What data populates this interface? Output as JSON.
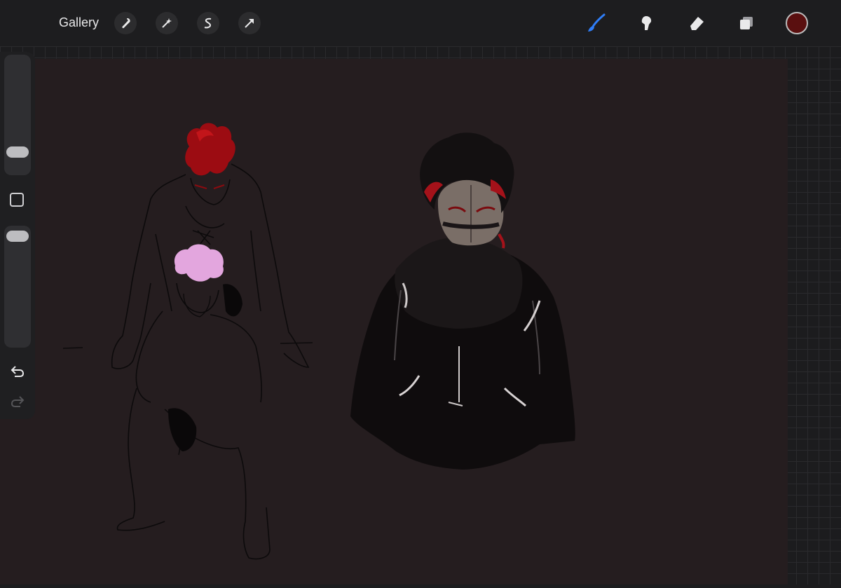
{
  "toolbar": {
    "gallery_label": "Gallery",
    "left_tools": [
      "wrench-icon",
      "magic-wand-icon",
      "selection-icon",
      "transform-arrow-icon"
    ],
    "right_tools": [
      "brush-icon",
      "smudge-icon",
      "eraser-icon",
      "layers-icon"
    ],
    "active_tool": "brush",
    "accent_color": "#2f7df6",
    "current_color": "#5a0f0f"
  },
  "sidebar": {
    "brush_size_level": 0.22,
    "opacity_level": 0.95,
    "controls": [
      "brush-size-slider",
      "modify-button",
      "opacity-slider",
      "undo-icon",
      "redo-icon"
    ]
  },
  "canvas": {
    "background_color": "#251d1f",
    "artwork": "character-sketches"
  }
}
